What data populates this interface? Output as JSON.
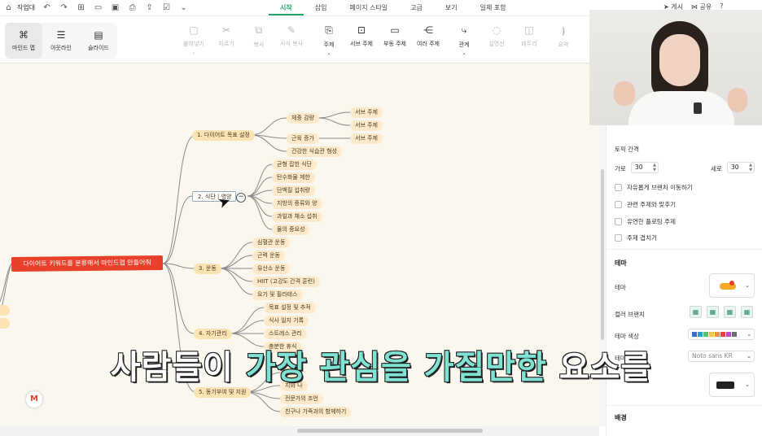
{
  "menubar": {
    "workbench": "작업대",
    "tabs": [
      {
        "label": "시작",
        "active": true
      },
      {
        "label": "삽입"
      },
      {
        "label": "페이지 스타일"
      },
      {
        "label": "고급"
      },
      {
        "label": "보기"
      },
      {
        "label": "일체 포함"
      }
    ],
    "publish": "게시",
    "share": "공유",
    "help": "?"
  },
  "ribbon": {
    "views": [
      {
        "label": "마인드 맵",
        "icon": "mindmap-icon"
      },
      {
        "label": "아웃라인",
        "icon": "outline-icon"
      },
      {
        "label": "슬라이드",
        "icon": "slide-icon"
      }
    ],
    "paste": "붙여넣기",
    "cut": "자르기",
    "copy": "복사",
    "format_copy": "서식 복사",
    "topic": "주제",
    "subtopic": "서브 주제",
    "floating_topic": "부동 주제",
    "multi_topic": "여러 주제",
    "relation": "관계",
    "callout": "설명선",
    "boundary": "테두리",
    "summary": "요약"
  },
  "mindmap": {
    "root": "다이어트 키워드를 분류해서 마인드맵 만들어줘",
    "branches": [
      {
        "label": "1. 다이어트 목표 설정",
        "children": [
          "체중 감량",
          "근육 증가",
          "건강한 식습관 형성"
        ],
        "grandchildren": [
          "서브 주제",
          "서브 주제",
          "서브 주제"
        ]
      },
      {
        "label": "2. 식단 | 영양",
        "children": [
          "균형 잡힌 식단",
          "탄수화물 제한",
          "단백질 섭취량",
          "지방의 종류와 양",
          "과일과 채소 섭취",
          "물의 중요성"
        ]
      },
      {
        "label": "3. 운동",
        "children": [
          "심혈관 운동",
          "근력 운동",
          "유산소 운동",
          "HIIT (고강도 간격 훈련)",
          "요가 및 필라테스"
        ]
      },
      {
        "label": "4. 자기관리",
        "children": [
          "목표 설정 및 추적",
          "식사 일지 기록",
          "스트레스 관리",
          "충분한 휴식"
        ]
      },
      {
        "label": "5. 동기부여 및 지원",
        "children": [
          "부여",
          "지와 나",
          "전문가의 조언",
          "친구나 가족과의 함께하기"
        ]
      }
    ]
  },
  "panel": {
    "topic_spacing": "토픽 간격",
    "horizontal": "가로",
    "horizontal_value": "30",
    "vertical": "세로",
    "vertical_value": "30",
    "options": [
      "자유롭게 브랜치 이동하기",
      "관련 주제와 맞추기",
      "유연한 플로팅 주제",
      "주제 겹치기"
    ],
    "theme_header": "테마",
    "theme": "테마",
    "color_branch": "컬러 브랜치",
    "theme_color": "테마 색상",
    "theme_font": "테마 글꼴",
    "font_value": "Noto sans KR",
    "background": "배경"
  },
  "subtitle": {
    "w1": "사람들이 ",
    "h": "가장 관심을 가질만한",
    "w2": " 요소를"
  },
  "colors": {
    "accent": "#21a366",
    "root": "#e8402a",
    "node": "#fbe3b4",
    "canvas": "#faf7ef"
  }
}
